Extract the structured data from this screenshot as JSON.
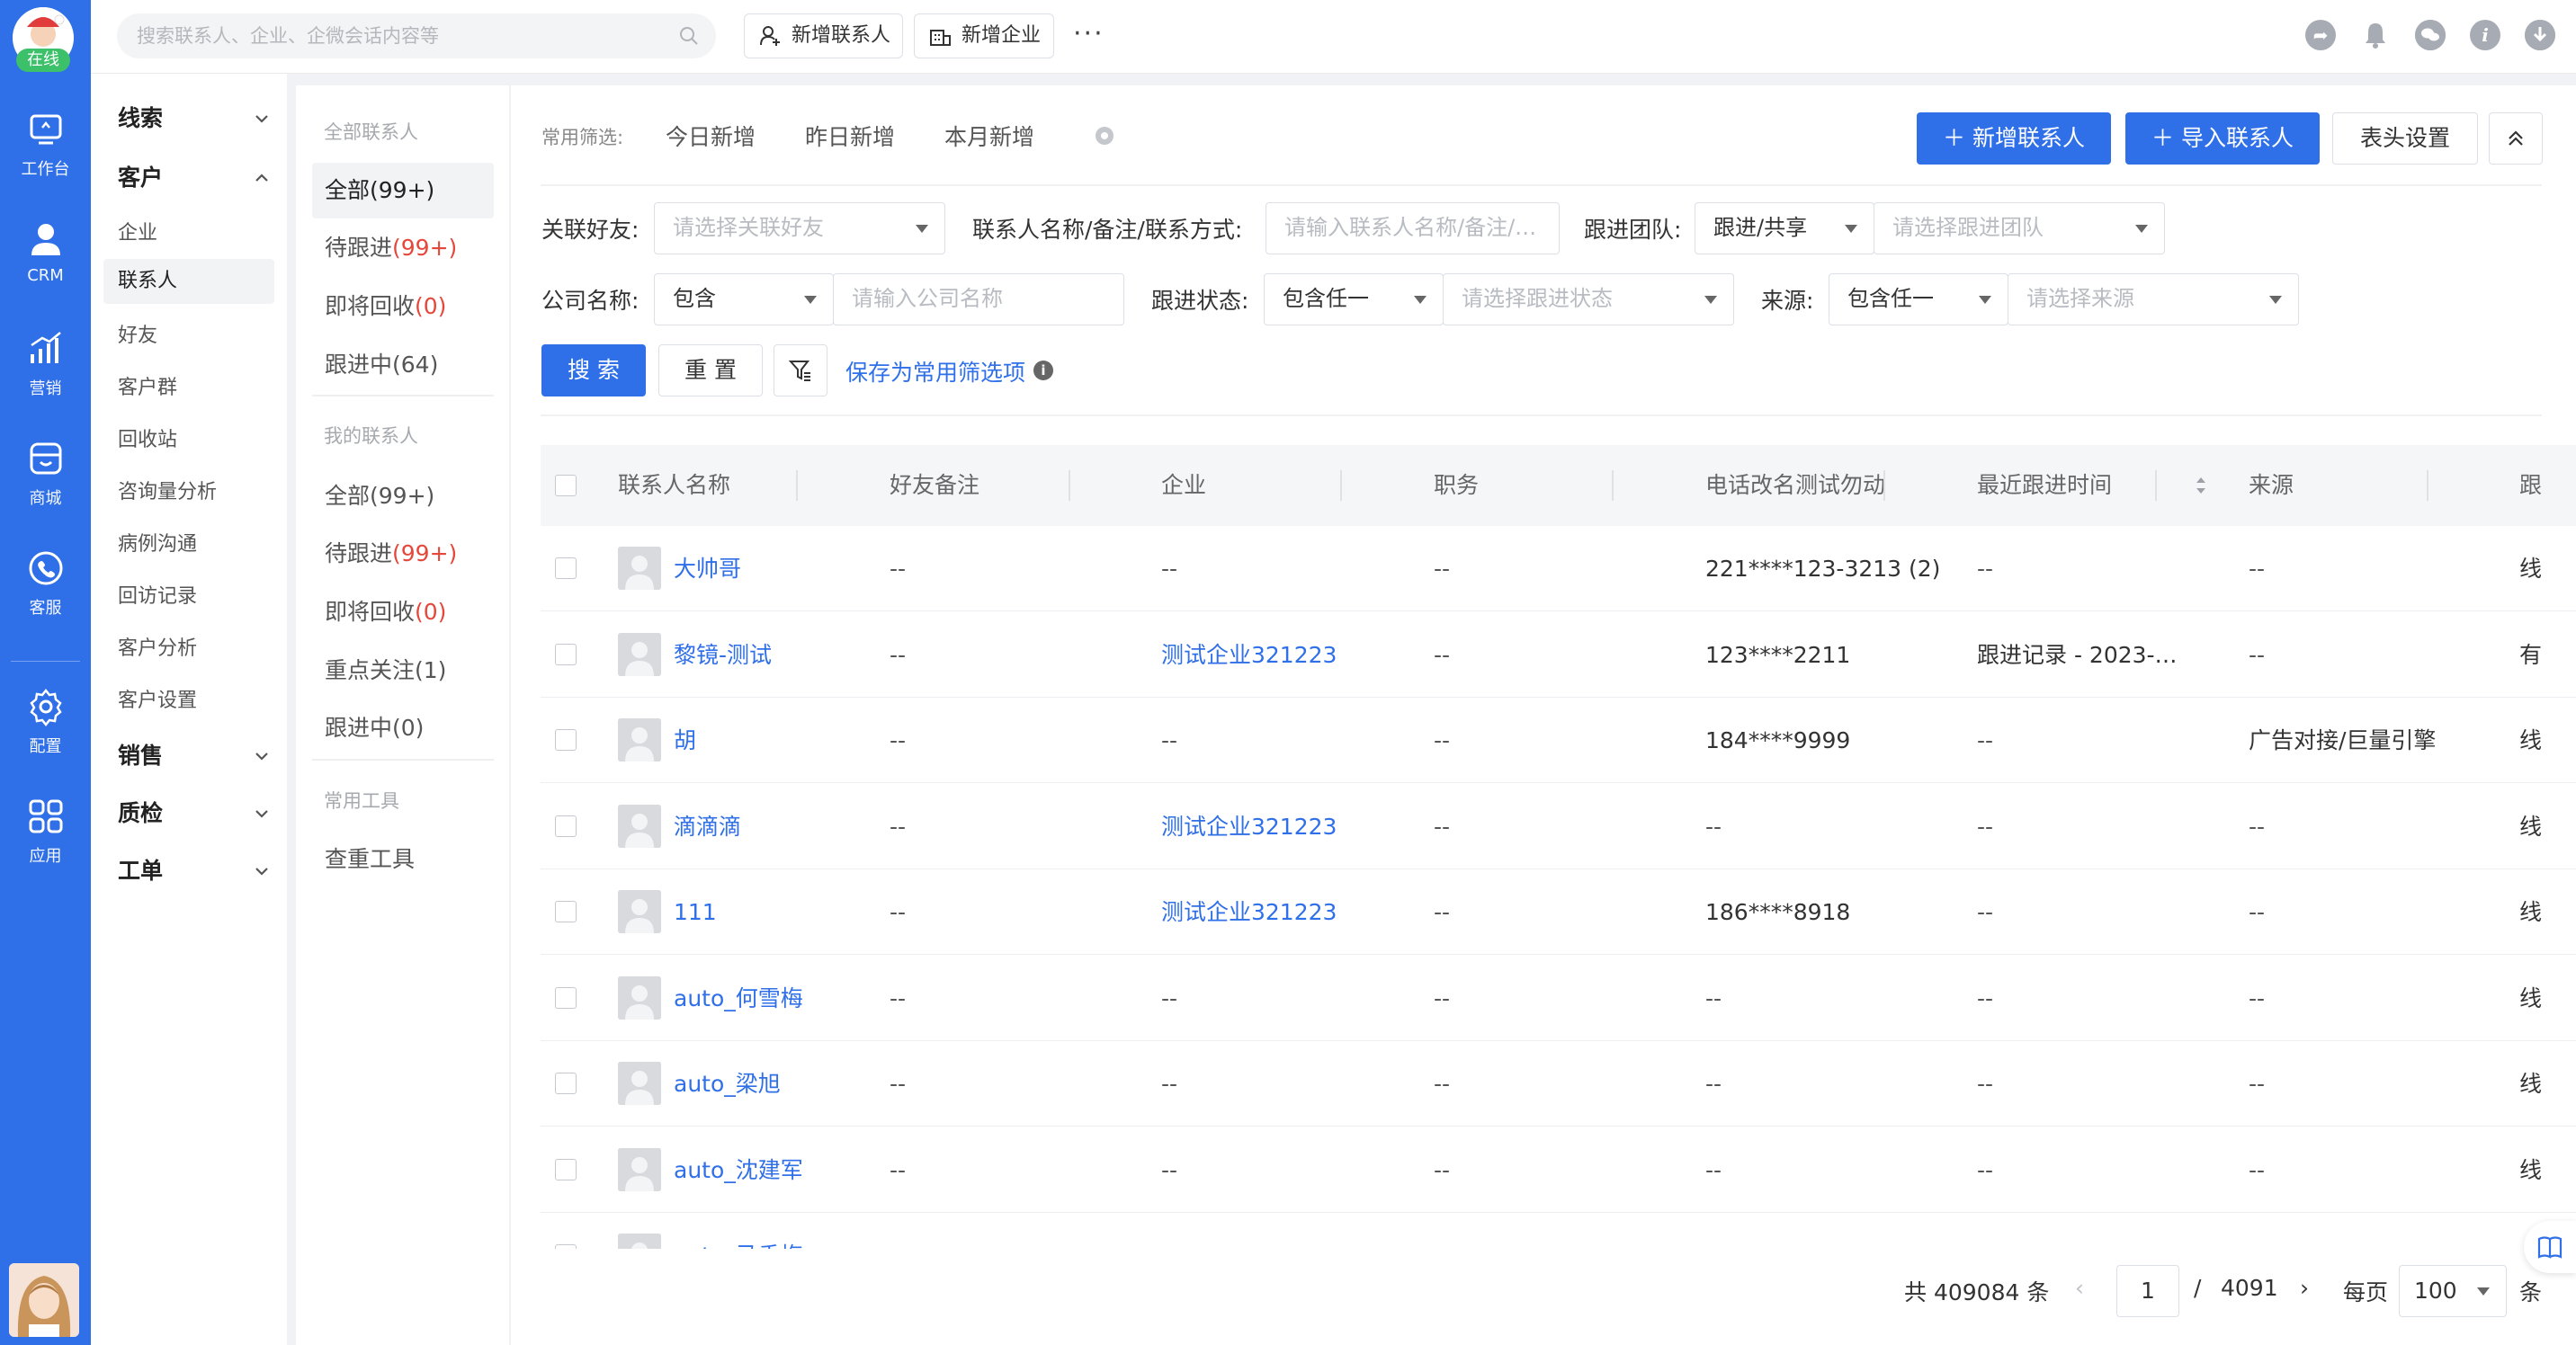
{
  "rail": {
    "status": "在线",
    "items": [
      {
        "label": "工作台",
        "icon": "workbench-icon"
      },
      {
        "label": "CRM",
        "icon": "user-icon"
      },
      {
        "label": "营销",
        "icon": "chart-bars-icon"
      },
      {
        "label": "商城",
        "icon": "store-icon"
      },
      {
        "label": "客服",
        "icon": "phone-icon"
      },
      {
        "label": "配置",
        "icon": "gear-icon"
      },
      {
        "label": "应用",
        "icon": "apps-grid-icon"
      }
    ]
  },
  "topbar": {
    "search_placeholder": "搜索联系人、企业、企微会话内容等",
    "add_contact": "新增联系人",
    "add_company": "新增企业",
    "more": "···"
  },
  "nav": {
    "groups": [
      {
        "label": "线索",
        "expanded": false
      },
      {
        "label": "客户",
        "expanded": true,
        "items": [
          "企业",
          "联系人",
          "好友",
          "客户群",
          "回收站",
          "咨询量分析",
          "病例沟通",
          "回访记录",
          "客户分析",
          "客户设置"
        ],
        "active": "联系人"
      },
      {
        "label": "销售",
        "expanded": false
      },
      {
        "label": "质检",
        "expanded": false
      },
      {
        "label": "工单",
        "expanded": false
      }
    ]
  },
  "categories": {
    "all_header": "全部联系人",
    "all": [
      {
        "label": "全部",
        "count": "(99+)",
        "red": false,
        "active": true
      },
      {
        "label": "待跟进",
        "count": "(99+)",
        "red": true
      },
      {
        "label": "即将回收",
        "count": "(0)",
        "red": true
      },
      {
        "label": "跟进中",
        "count": "(64)",
        "red": false
      }
    ],
    "mine_header": "我的联系人",
    "mine": [
      {
        "label": "全部",
        "count": "(99+)",
        "red": false
      },
      {
        "label": "待跟进",
        "count": "(99+)",
        "red": true
      },
      {
        "label": "即将回收",
        "count": "(0)",
        "red": true
      },
      {
        "label": "重点关注",
        "count": "(1)",
        "red": false
      },
      {
        "label": "跟进中",
        "count": "(0)",
        "red": false
      }
    ],
    "tools_header": "常用工具",
    "tools": [
      "查重工具"
    ]
  },
  "filters": {
    "quick_label": "常用筛选:",
    "quick": [
      "今日新增",
      "昨日新增",
      "本月新增"
    ],
    "buttons": {
      "add": "新增联系人",
      "import": "导入联系人",
      "columns": "表头设置"
    },
    "friend_label": "关联好友:",
    "friend_placeholder": "请选择关联好友",
    "name_label": "联系人名称/备注/联系方式:",
    "name_placeholder": "请输入联系人名称/备注/联系方式",
    "team_label": "跟进团队:",
    "team_mode": "跟进/共享",
    "team_placeholder": "请选择跟进团队",
    "company_label": "公司名称:",
    "company_mode": "包含",
    "company_placeholder": "请输入公司名称",
    "status_label": "跟进状态:",
    "status_mode": "包含任一",
    "status_placeholder": "请选择跟进状态",
    "source_label": "来源:",
    "source_mode": "包含任一",
    "source_placeholder": "请选择来源",
    "search": "搜 索",
    "reset": "重 置",
    "save": "保存为常用筛选项"
  },
  "table": {
    "columns": [
      "联系人名称",
      "好友备注",
      "企业",
      "职务",
      "电话改名测试勿动",
      "最近跟进时间",
      "来源",
      "跟"
    ],
    "rows": [
      {
        "name": "大帅哥",
        "note": "--",
        "company": "--",
        "title": "--",
        "phone": "221****123-3213 (2)",
        "last": "--",
        "source": "--",
        "extra": "线"
      },
      {
        "name": "黎镜-测试",
        "note": "--",
        "company": "测试企业321223",
        "title": "--",
        "phone": "123****2211",
        "last": "跟进记录 - 2023-…",
        "source": "--",
        "extra": "有"
      },
      {
        "name": "胡",
        "note": "--",
        "company": "--",
        "title": "--",
        "phone": "184****9999",
        "last": "--",
        "source": "广告对接/巨量引擎",
        "extra": "线"
      },
      {
        "name": "滴滴滴",
        "note": "--",
        "company": "测试企业321223",
        "title": "--",
        "phone": "--",
        "last": "--",
        "source": "--",
        "extra": "线"
      },
      {
        "name": "111",
        "note": "--",
        "company": "测试企业321223",
        "title": "--",
        "phone": "186****8918",
        "last": "--",
        "source": "--",
        "extra": "线"
      },
      {
        "name": "auto_何雪梅",
        "note": "--",
        "company": "--",
        "title": "--",
        "phone": "--",
        "last": "--",
        "source": "--",
        "extra": "线"
      },
      {
        "name": "auto_梁旭",
        "note": "--",
        "company": "--",
        "title": "--",
        "phone": "--",
        "last": "--",
        "source": "--",
        "extra": "线"
      },
      {
        "name": "auto_沈建军",
        "note": "--",
        "company": "--",
        "title": "--",
        "phone": "--",
        "last": "--",
        "source": "--",
        "extra": "线"
      },
      {
        "name": "auto_马香梅",
        "note": "",
        "company": "",
        "title": "",
        "phone": "",
        "last": "",
        "source": "",
        "extra": ""
      }
    ]
  },
  "pagination": {
    "total": "共 409084 条",
    "page": "1",
    "sep": "/",
    "pages": "4091",
    "per_label": "每页",
    "per": "100",
    "unit": "条"
  },
  "colors": {
    "primary": "#2f6fe8",
    "danger": "#e5483b",
    "rail": "#2f6fe8"
  }
}
